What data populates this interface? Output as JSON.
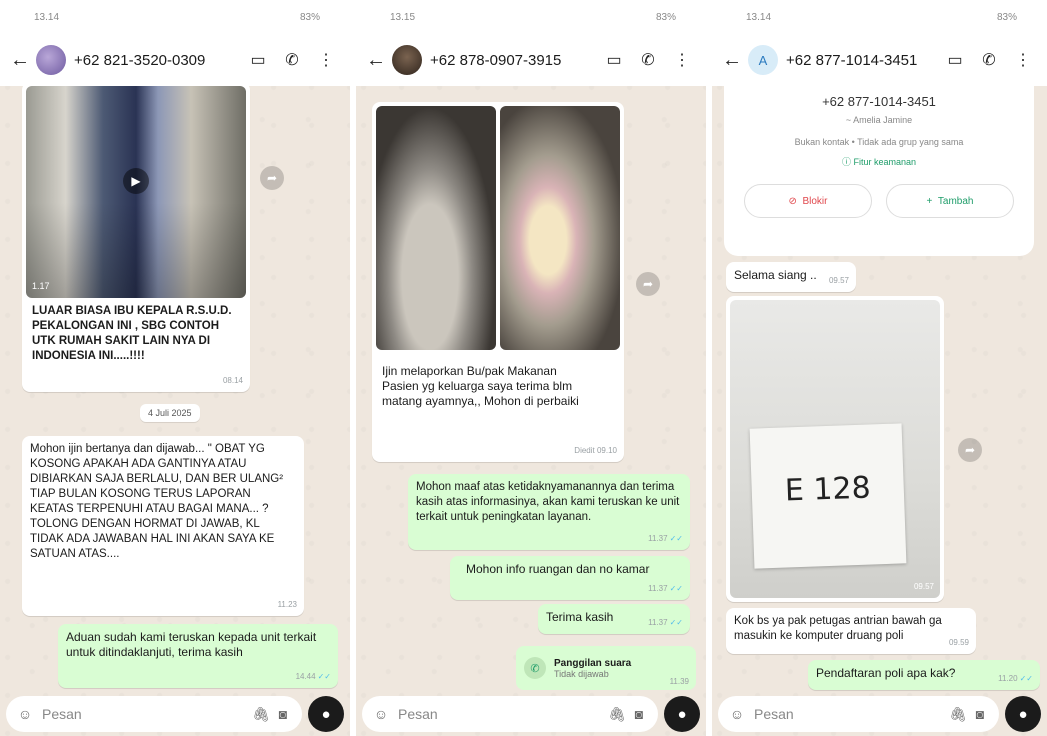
{
  "panel1": {
    "status_time": "13.14",
    "status_right": "83%",
    "contact": "+62 821-3520-0309",
    "video_duration": "1.17",
    "forwarded_text": "LUAAR BIASA IBU KEPALA R.S.U.D. PEKALONGAN INI , SBG CONTOH UTK RUMAH SAKIT LAIN NYA DI INDONESIA INI.....!!!!",
    "forwarded_time": "08.14",
    "date_chip": "4 Juli 2025",
    "msg2_text": "Mohon ijin bertanya dan dijawab... \" OBAT YG KOSONG APAKAH ADA GANTINYA ATAU DIBIARKAN SAJA BERLALU, DAN BER ULANG² TIAP BULAN KOSONG TERUS LAPORAN KEATAS TERPENUHI ATAU BAGAI MANA... ? TOLONG DENGAN HORMAT DI JAWAB, KL TIDAK ADA JAWABAN HAL INI AKAN SAYA KE SATUAN ATAS....",
    "msg2_time": "11.23",
    "reply_text": "Aduan sudah kami teruskan kepada unit terkait untuk ditindaklanjuti, terima kasih",
    "reply_time": "14.44"
  },
  "panel2": {
    "status_time": "13.15",
    "status_right": "83%",
    "contact": "+62 878-0907-3915",
    "msg1_text": "Ijin melaporkan Bu/pak Makanan Pasien yg keluarga saya terima blm matang ayamnya,, Mohon di perbaiki",
    "msg1_time": "Diedit 09.10",
    "reply1_text": "Mohon maaf atas ketidaknyamanannya dan terima kasih atas informasinya, akan kami teruskan ke unit terkait untuk peningkatan layanan.",
    "reply1_time": "11.37",
    "reply2_text": "Mohon info ruangan dan no kamar",
    "reply2_time": "11.37",
    "reply3_text": "Terima kasih",
    "reply3_time": "11.37",
    "call_title": "Panggilan suara",
    "call_status": "Tidak dijawab",
    "call_time": "11.39"
  },
  "panel3": {
    "status_time": "13.14",
    "status_right": "83%",
    "avatar_letter": "A",
    "contact": "+62 877-1014-3451",
    "card_phone": "+62 877-1014-3451",
    "card_name": "~ Amelia Jamine",
    "card_info": "Bukan kontak • Tidak ada grup yang sama",
    "card_security": "Fitur keamanan",
    "btn_block": "Blokir",
    "btn_add": "Tambah",
    "msg1_text": "Selama siang ..",
    "msg1_time": "09.57",
    "ticket_number": "E 128",
    "img_time": "09.57",
    "msg2_text": "Kok bs ya pak petugas antrian bawah ga masukin ke komputer druang poli",
    "msg2_time": "09.59",
    "reply_text": "Pendaftaran poli apa kak?",
    "reply_time": "11.20"
  },
  "input": {
    "placeholder": "Pesan"
  },
  "icons": {
    "video_call": "▭",
    "voice_call": "✆",
    "menu": "⋮",
    "back": "←",
    "forward": "➦",
    "emoji": "☺",
    "attach": "🖇",
    "camera": "◙",
    "mic": "●",
    "play": "▶"
  }
}
